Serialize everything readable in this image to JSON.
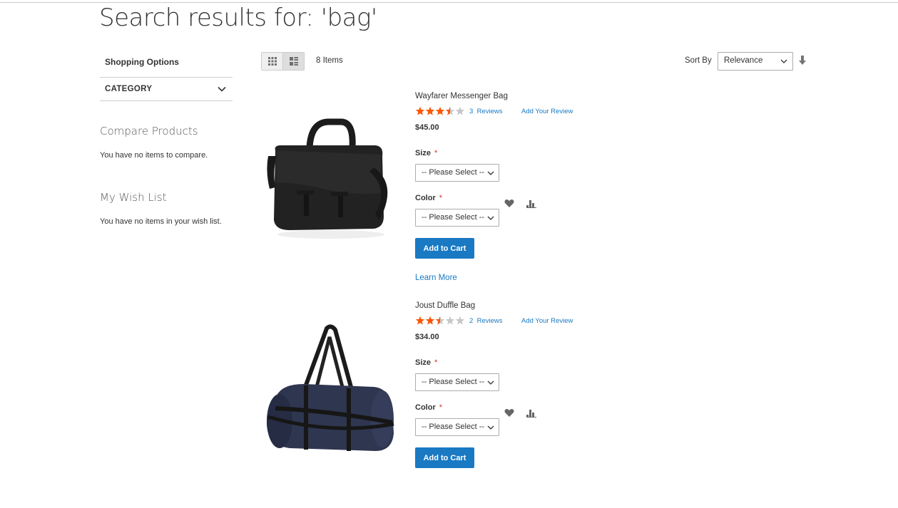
{
  "page": {
    "title": "Search results for: 'bag'"
  },
  "sidebar": {
    "shopping_options": "Shopping Options",
    "filter_category": "CATEGORY",
    "compare_heading": "Compare Products",
    "compare_empty": "You have no items to compare.",
    "wishlist_heading": "My Wish List",
    "wishlist_empty": "You have no items in your wish list."
  },
  "toolbar": {
    "view_modes": [
      "grid",
      "list"
    ],
    "active_view": "list",
    "amount": "8 Items",
    "sort_label": "Sort By",
    "sort_value": "Relevance",
    "sort_direction_icon": "arrow-down-icon"
  },
  "products": [
    {
      "name": "Wayfarer Messenger Bag",
      "rating": 3.5,
      "rating_max": 5,
      "reviews_count": "3",
      "reviews_label": "Reviews",
      "add_review": "Add Your Review",
      "price": "$45.00",
      "size_label": "Size",
      "size_value": "-- Please Select --",
      "color_label": "Color",
      "color_value": "-- Please Select --",
      "add_to_cart": "Add to Cart",
      "learn_more": "Learn More"
    },
    {
      "name": "Joust Duffle Bag",
      "rating": 2.5,
      "rating_max": 5,
      "reviews_count": "2",
      "reviews_label": "Reviews",
      "add_review": "Add Your Review",
      "price": "$34.00",
      "size_label": "Size",
      "size_value": "-- Please Select --",
      "color_label": "Color",
      "color_value": "-- Please Select --",
      "add_to_cart": "Add to Cart"
    }
  ],
  "colors": {
    "link": "#1979c3",
    "button": "#1979c3",
    "star": "#ff5501",
    "star_empty": "#c7c7c7",
    "required": "#e02b27"
  },
  "required_marker": "*"
}
